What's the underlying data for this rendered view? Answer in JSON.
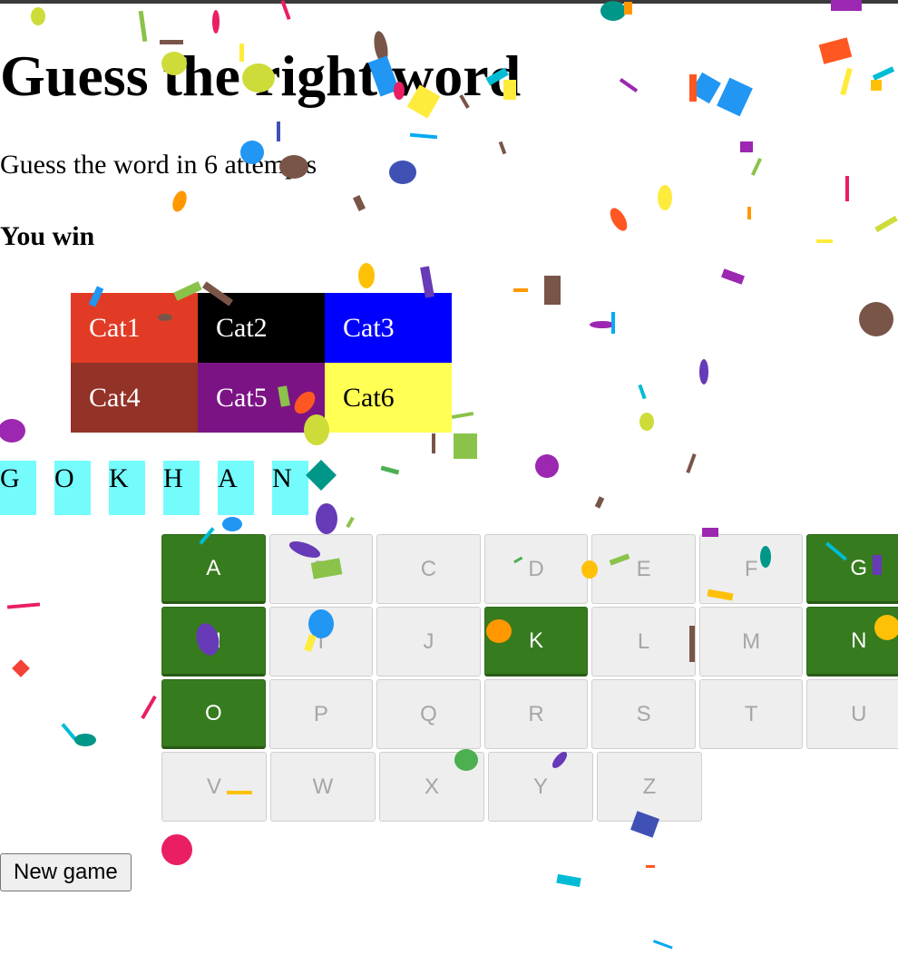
{
  "title": "Guess the right word",
  "subtitle": "Guess the word in 6 attempts",
  "status": "You win",
  "categories": [
    {
      "label": "Cat1",
      "color": "#e23b25",
      "text_color": "#ffffff"
    },
    {
      "label": "Cat2",
      "color": "#000000",
      "text_color": "#ffffff"
    },
    {
      "label": "Cat3",
      "color": "#0000ff",
      "text_color": "#ffffff"
    },
    {
      "label": "Cat4",
      "color": "#933226",
      "text_color": "#ffffff"
    },
    {
      "label": "Cat5",
      "color": "#7b1385",
      "text_color": "#ffffff"
    },
    {
      "label": "Cat6",
      "color": "#ffff54",
      "text_color": "#000000"
    }
  ],
  "word": [
    "G",
    "O",
    "K",
    "H",
    "A",
    "N"
  ],
  "keyboard": {
    "rows": [
      [
        "A",
        "B",
        "C",
        "D",
        "E",
        "F",
        "G"
      ],
      [
        "H",
        "I",
        "J",
        "K",
        "L",
        "M",
        "N"
      ],
      [
        "O",
        "P",
        "Q",
        "R",
        "S",
        "T",
        "U"
      ],
      [
        "V",
        "W",
        "X",
        "Y",
        "Z"
      ]
    ],
    "guessed": [
      "A",
      "G",
      "H",
      "K",
      "N",
      "O"
    ]
  },
  "new_game_label": "New game",
  "colors": {
    "letter_bg": "#74fcfd",
    "key_hit": "#367b1e",
    "key_idle": "#eeeeee"
  }
}
